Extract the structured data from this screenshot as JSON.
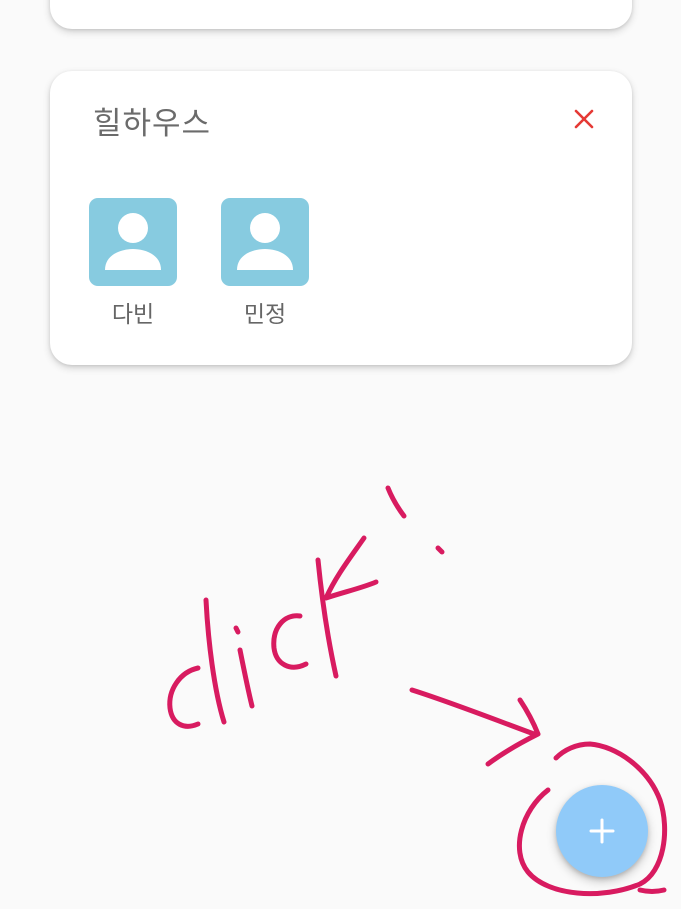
{
  "house_card": {
    "title": "힐하우스",
    "close_icon": "close-icon",
    "members": [
      {
        "name": "다빈",
        "icon": "person-icon"
      },
      {
        "name": "민정",
        "icon": "person-icon"
      }
    ]
  },
  "fab": {
    "icon": "plus-icon"
  },
  "annotation": {
    "text": "click !"
  },
  "colors": {
    "background": "#fafafa",
    "card": "#ffffff",
    "avatar_bg": "#87cbe0",
    "close_icon": "#e53935",
    "fab": "#90caf9",
    "annotation_ink": "#d81b60"
  }
}
